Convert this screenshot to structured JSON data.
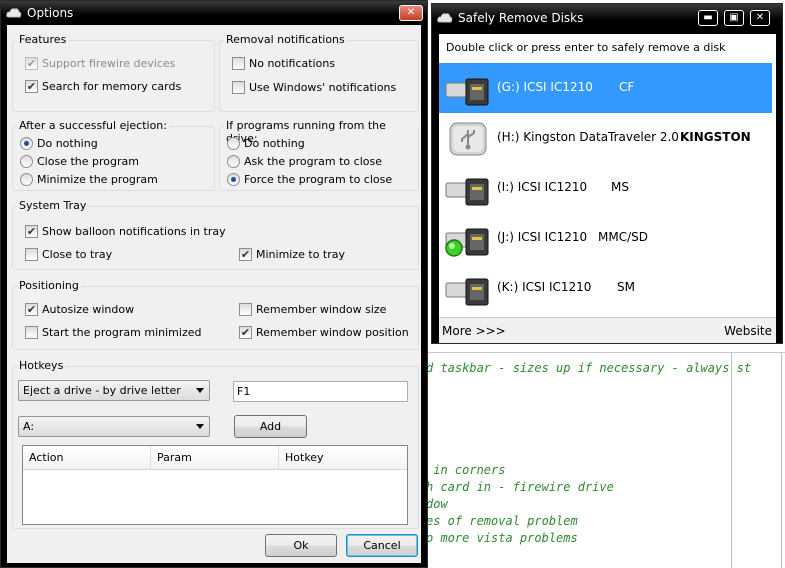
{
  "background_code": {
    "lines": [
      "d taskbar - sizes up if necessary - always st",
      " in corners",
      "h card in - firewire drive",
      "dow",
      "es of removal problem",
      "o more vista problems"
    ]
  },
  "options_window": {
    "title": "Options",
    "close_glyph": "✕",
    "features": {
      "label": "Features",
      "support_firewire": {
        "label": "Support firewire devices",
        "checked": true,
        "disabled": true
      },
      "search_memory_cards": {
        "label": "Search for memory cards",
        "checked": true
      }
    },
    "removal_notifications": {
      "label": "Removal notifications",
      "no_notifications": {
        "label": "No notifications",
        "checked": false
      },
      "windows_notifications": {
        "label": "Use Windows' notifications",
        "checked": false
      }
    },
    "after_ejection": {
      "label": "After a successful ejection:",
      "options": [
        "Do nothing",
        "Close the program",
        "Minimize the program"
      ],
      "selected": 0
    },
    "if_programs_running": {
      "label": "If programs running from the drive:",
      "options": [
        "Do nothing",
        "Ask the program to close",
        "Force the program to close"
      ],
      "selected": 2
    },
    "system_tray": {
      "label": "System Tray",
      "balloon": {
        "label": "Show balloon notifications in tray",
        "checked": true
      },
      "close_to_tray": {
        "label": "Close to tray",
        "checked": false
      },
      "minimize_to_tray": {
        "label": "Minimize to tray",
        "checked": true
      }
    },
    "positioning": {
      "label": "Positioning",
      "autosize": {
        "label": "Autosize window",
        "checked": true
      },
      "start_minimized": {
        "label": "Start the program minimized",
        "checked": false
      },
      "remember_size": {
        "label": "Remember window size",
        "checked": false
      },
      "remember_position": {
        "label": "Remember window position",
        "checked": true
      }
    },
    "hotkeys": {
      "label": "Hotkeys",
      "action_select": "Eject a drive - by drive letter",
      "key_value": "F1",
      "drive_select": "A:",
      "add_label": "Add",
      "columns": [
        "Action",
        "Param",
        "Hotkey"
      ]
    },
    "ok_label": "Ok",
    "cancel_label": "Cancel"
  },
  "safely_remove_window": {
    "title": "Safely Remove Disks",
    "minimize_glyph": "▬",
    "maximize_glyph": "▣",
    "close_glyph": "✕",
    "instruction": "Double click or press enter to safely remove a disk",
    "disks": [
      {
        "name": "(G:) ICSI IC1210",
        "extra": "CF",
        "icon": "card-reader-icon",
        "selected": true
      },
      {
        "name": "(H:) Kingston DataTraveler 2.0",
        "extra": "KINGSTON",
        "icon": "usb-drive-icon",
        "selected": false
      },
      {
        "name": "(I:) ICSI IC1210",
        "extra": "MS",
        "icon": "card-reader-icon",
        "selected": false
      },
      {
        "name": "(J:) ICSI IC1210",
        "extra": "MMC/SD",
        "icon": "card-reader-active-icon",
        "selected": false
      },
      {
        "name": "(K:) ICSI IC1210",
        "extra": "SM",
        "icon": "card-reader-icon",
        "selected": false
      }
    ],
    "more_link": "More >>>",
    "website_link": "Website"
  },
  "colors": {
    "selection": "#3399ff",
    "code_comment": "#2f8a2f",
    "titlebar": "#000000"
  }
}
